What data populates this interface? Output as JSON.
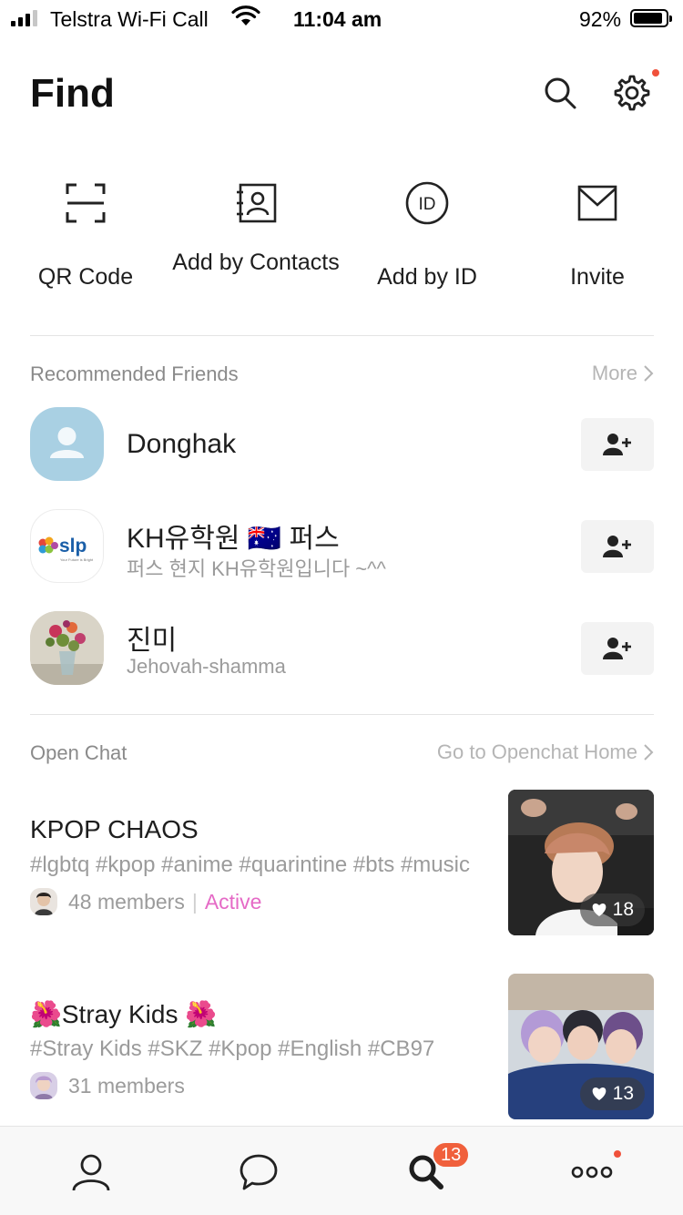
{
  "status_bar": {
    "carrier": "Telstra Wi-Fi Call",
    "time": "11:04 am",
    "battery_percent": "92%",
    "battery_level": 0.92,
    "signal_bars": 3
  },
  "header": {
    "title": "Find",
    "search_icon": "search-icon",
    "settings_icon": "gear-icon",
    "settings_has_notification": true
  },
  "quick_actions": [
    {
      "label": "QR Code",
      "icon": "qr-scan-icon"
    },
    {
      "label": "Add by Contacts",
      "icon": "contacts-book-icon"
    },
    {
      "label": "Add by ID",
      "icon": "id-circle-icon"
    },
    {
      "label": "Invite",
      "icon": "envelope-icon"
    }
  ],
  "recommended": {
    "title": "Recommended Friends",
    "more_label": "More",
    "friends": [
      {
        "name": "Donghak",
        "status": ""
      },
      {
        "name": "KH유학원 🇦🇺 퍼스",
        "status": "퍼스 현지 KH유학원입니다 ~^^"
      },
      {
        "name": "진미",
        "status": "Jehovah-shamma"
      }
    ],
    "slp_logo_text": "slp",
    "slp_logo_tagline": "Your Future is Bright"
  },
  "open_chat": {
    "title": "Open Chat",
    "home_link": "Go to Openchat Home",
    "chats": [
      {
        "name": "KPOP CHAOS",
        "tags": "#lgbtq #kpop #anime #quarintine #bts #music",
        "members": "48 members",
        "separator": "|",
        "activity": "Active",
        "likes": "18"
      },
      {
        "name": "🌺Stray Kids 🌺",
        "tags": "#Stray Kids #SKZ #Kpop #English #CB97",
        "members": "31 members",
        "separator": "",
        "activity": "",
        "likes": "13"
      }
    ]
  },
  "tab_bar": {
    "tabs": [
      {
        "icon": "person-icon"
      },
      {
        "icon": "chat-bubble-icon"
      },
      {
        "icon": "search-icon",
        "badge": "13"
      },
      {
        "icon": "more-dots-icon"
      }
    ]
  },
  "colors": {
    "accent_active": "#e56ac6",
    "badge": "#f0603c",
    "notification_dot": "#f0513b"
  }
}
